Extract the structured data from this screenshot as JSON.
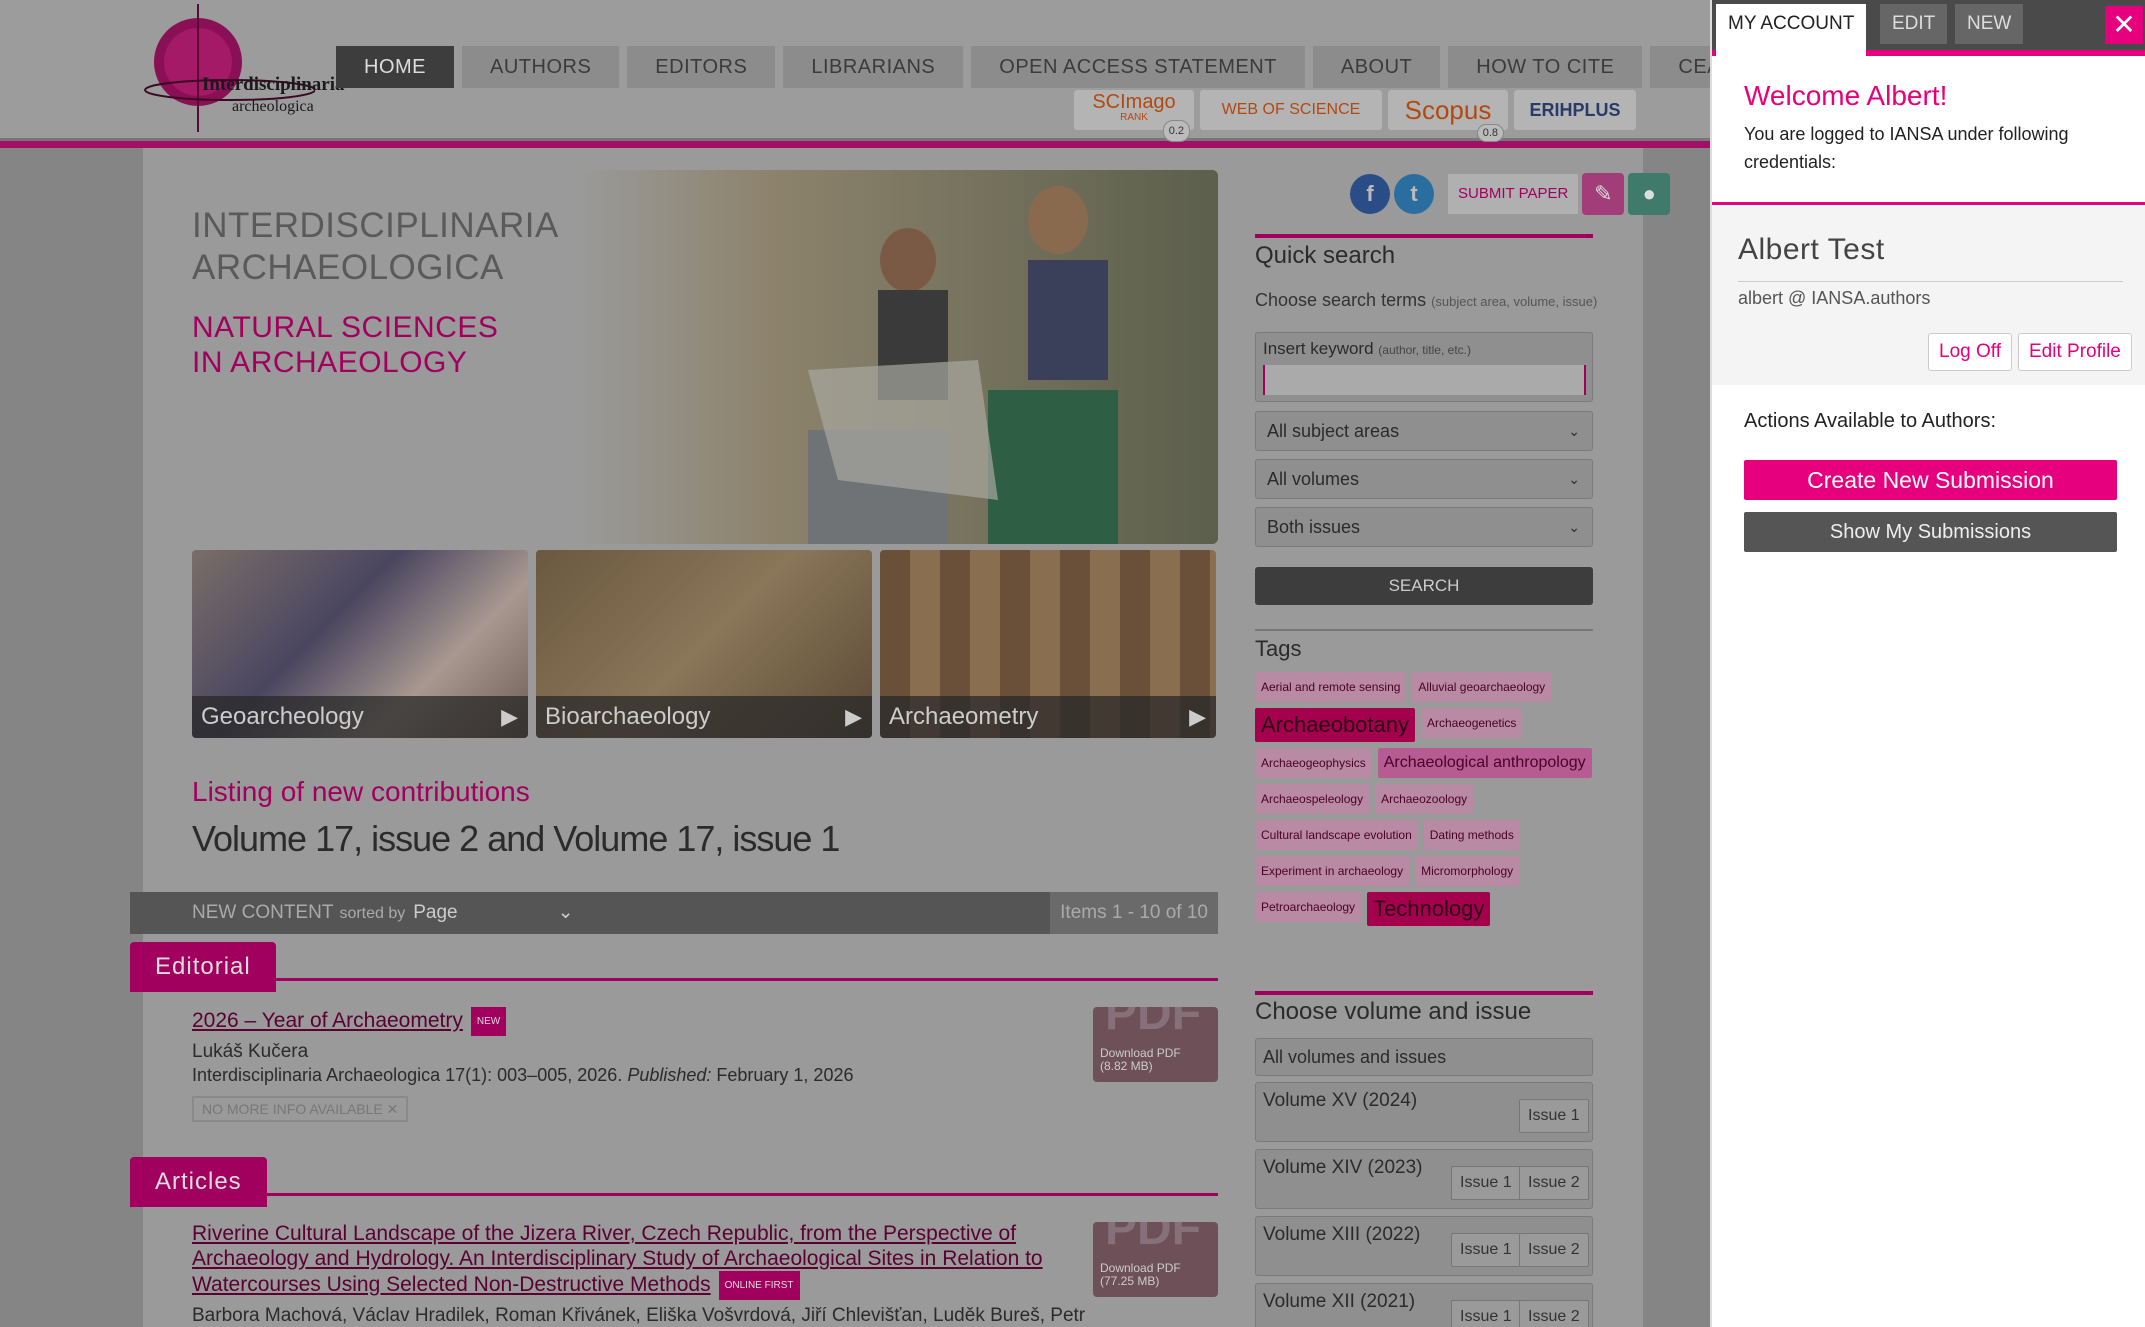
{
  "logo": {
    "line1": "Interdisciplinaria",
    "line2": "archeologica"
  },
  "nav": [
    "HOME",
    "AUTHORS",
    "EDITORS",
    "LIBRARIANS",
    "OPEN ACCESS STATEMENT",
    "ABOUT",
    "HOW TO CITE",
    "CEA"
  ],
  "badges": {
    "scimago": "SCImago",
    "scimago_rank": "RANK",
    "scimago_score": "0.2",
    "wos": "WEB OF SCIENCE",
    "scopus": "Scopus",
    "scopus_score": "0.8",
    "erih": "ERIHPLUS"
  },
  "journal": {
    "title_l1": "INTERDISCIPLINARIA",
    "title_l2": "ARCHAEOLOGICA",
    "sub_l1": "NATURAL SCIENCES",
    "sub_l2": "IN ARCHAEOLOGY"
  },
  "tiles": [
    "Geoarcheology",
    "Bioarchaeology",
    "Archaeometry"
  ],
  "listing": {
    "heading": "Listing of new contributions",
    "volume": "Volume 17, issue 2 and Volume 17, issue 1"
  },
  "newbar": {
    "label": "NEW CONTENT",
    "sorted": "sorted by",
    "sort_value": "Page",
    "items": "Items 1 - 10 of 10"
  },
  "sections": {
    "editorial": "Editorial",
    "articles": "Articles"
  },
  "article1": {
    "title": "2026 – Year of Archaeometry",
    "tag": "NEW",
    "author": "Lukáš Kučera",
    "ref": "Interdisciplinaria Archaeologica 17(1): 003–005, 2026.",
    "published_label": "Published:",
    "published": "February 1, 2026",
    "nomore": "NO MORE INFO AVAILABLE",
    "pdf_label": "Download PDF",
    "pdf_size": "(8.82 MB)"
  },
  "article2": {
    "title_l1": "Riverine Cultural Landscape of the Jizera River, Czech Republic, from the Perspective of",
    "title_l2": "Archaeology and Hydrology. An Interdisciplinary Study of Archaeological Sites in Relation to",
    "title_l3": "Watercourses Using Selected Non-Destructive Methods",
    "tag": "ONLINE FIRST",
    "authors": "Barbora Machová, Václav Hradilek, Roman Křivánek, Eliška Vošvrdová, Jiří Chlevišťan, Luděk Bureš, Petr",
    "pdf_label": "Download PDF",
    "pdf_size": "(77.25 MB)"
  },
  "pdf_big": "PDF",
  "sidebar": {
    "submit": "SUBMIT PAPER",
    "quick": "Quick search",
    "choose": "Choose search terms",
    "choose_hint": "(subject area, volume, issue)",
    "keyword": "Insert keyword",
    "keyword_hint": "(author, title, etc.)",
    "sel1": "All subject areas",
    "sel2": "All volumes",
    "sel3": "Both issues",
    "search": "SEARCH",
    "tags_h": "Tags",
    "choose_vol": "Choose volume and issue",
    "all_vol": "All volumes and issues"
  },
  "tags": [
    {
      "t": "Aerial and remote sensing",
      "s": "sm"
    },
    {
      "t": "Alluvial geoarchaeology",
      "s": "sm"
    },
    {
      "t": "Archaeobotany",
      "s": "lg"
    },
    {
      "t": "Archaeogenetics",
      "s": "sm"
    },
    {
      "t": "Archaeogeophysics",
      "s": "sm"
    },
    {
      "t": "Archaeological anthropology",
      "s": "md"
    },
    {
      "t": "Archaeospeleology",
      "s": "sm"
    },
    {
      "t": "Archaeozoology",
      "s": "sm"
    },
    {
      "t": "Cultural landscape evolution",
      "s": "sm"
    },
    {
      "t": "Dating methods",
      "s": "sm"
    },
    {
      "t": "Experiment in archaeology",
      "s": "sm"
    },
    {
      "t": "Micromorphology",
      "s": "sm"
    },
    {
      "t": "Petroarchaeology",
      "s": "sm"
    },
    {
      "t": "Technology",
      "s": "lg"
    }
  ],
  "volumes": [
    {
      "name": "Volume XV (2024)",
      "issues": [
        "Issue 1"
      ]
    },
    {
      "name": "Volume XIV (2023)",
      "issues": [
        "Issue 1",
        "Issue 2"
      ]
    },
    {
      "name": "Volume XIII (2022)",
      "issues": [
        "Issue 1",
        "Issue 2"
      ]
    },
    {
      "name": "Volume XII (2021)",
      "issues": [
        "Issue 1",
        "Issue 2"
      ]
    }
  ],
  "account": {
    "tabs": [
      "MY ACCOUNT",
      "EDIT",
      "NEW"
    ],
    "close": "✕",
    "welcome": "Welcome Albert!",
    "logged_l1": "You are logged to IANSA under following",
    "logged_l2": "credentials:",
    "name": "Albert Test",
    "user": "albert @ IANSA.authors",
    "logoff": "Log Off",
    "edit": "Edit Profile",
    "actions": "Actions Available to Authors:",
    "create": "Create New Submission",
    "show": "Show My Submissions"
  },
  "colors": {
    "accent": "#e6007e",
    "dim_accent": "#a2005f"
  }
}
